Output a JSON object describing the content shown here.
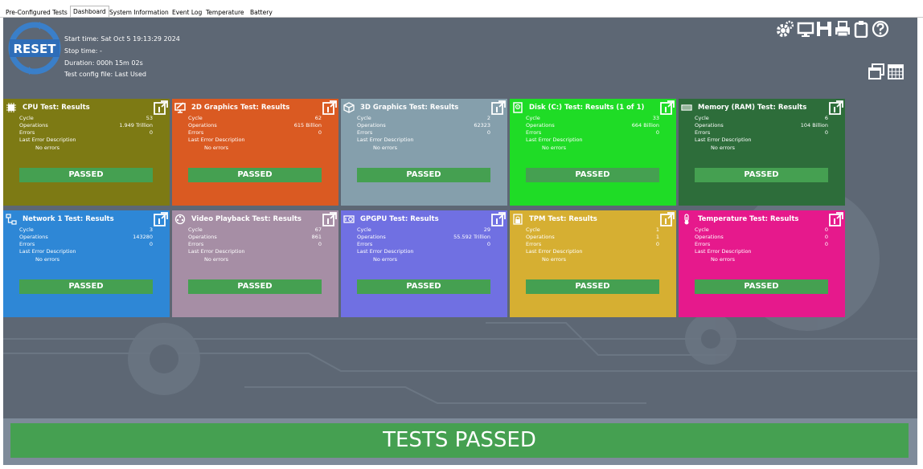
{
  "tabs": [
    {
      "label": "Pre-Configured Tests",
      "active": false
    },
    {
      "label": "Dashboard",
      "active": true
    },
    {
      "label": "System Information",
      "active": false
    },
    {
      "label": "Event Log",
      "active": false
    },
    {
      "label": "Temperature",
      "active": false
    },
    {
      "label": "Battery",
      "active": false
    }
  ],
  "reset_label": "RESET",
  "info": {
    "start_time": "Start time: Sat Oct  5 19:13:29 2024",
    "stop_time": "Stop time: -",
    "duration": "Duration: 000h 15m 02s",
    "config": "Test config file: Last Used"
  },
  "toolbar": [
    "gear-icon",
    "monitor-icon",
    "save-icon",
    "printer-icon",
    "clipboard-icon",
    "help-icon"
  ],
  "field_labels": {
    "cycle": "Cycle",
    "operations": "Operations",
    "errors": "Errors",
    "last_error": "Last Error Description"
  },
  "cards": [
    {
      "title": "CPU Test: Results",
      "icon": "cpu-icon",
      "color": "#7d7a14",
      "cycle": "53",
      "operations": "1.949 Trillion",
      "errors": "0",
      "error_desc": "No errors",
      "status": "PASSED"
    },
    {
      "title": "2D Graphics Test: Results",
      "icon": "2d-graphics-icon",
      "color": "#da5a22",
      "cycle": "62",
      "operations": "615 Billion",
      "errors": "0",
      "error_desc": "No errors",
      "status": "PASSED"
    },
    {
      "title": "3D Graphics Test: Results",
      "icon": "3d-graphics-icon",
      "color": "#859fac",
      "cycle": "2",
      "operations": "62323",
      "errors": "0",
      "error_desc": "No errors",
      "status": "PASSED"
    },
    {
      "title": "Disk (C:) Test: Results (1 of 1)",
      "icon": "disk-icon",
      "color": "#1fdc26",
      "cycle": "33",
      "operations": "664 Billion",
      "errors": "0",
      "error_desc": "No errors",
      "status": "PASSED"
    },
    {
      "title": "Memory (RAM) Test: Results",
      "icon": "memory-icon",
      "color": "#2d6d3a",
      "cycle": "6",
      "operations": "104 Billion",
      "errors": "0",
      "error_desc": "No errors",
      "status": "PASSED"
    },
    {
      "title": "Network 1 Test: Results",
      "icon": "network-icon",
      "color": "#2e87d6",
      "cycle": "3",
      "operations": "143280",
      "errors": "0",
      "error_desc": "No errors",
      "status": "PASSED"
    },
    {
      "title": "Video Playback Test: Results",
      "icon": "video-icon",
      "color": "#a68ea5",
      "cycle": "67",
      "operations": "861",
      "errors": "0",
      "error_desc": "No errors",
      "status": "PASSED"
    },
    {
      "title": "GPGPU Test: Results",
      "icon": "gpgpu-icon",
      "color": "#7070e2",
      "cycle": "29",
      "operations": "55.592 Trillion",
      "errors": "0",
      "error_desc": "No errors",
      "status": "PASSED"
    },
    {
      "title": "TPM Test: Results",
      "icon": "tpm-icon",
      "color": "#d6af32",
      "cycle": "1",
      "operations": "1",
      "errors": "0",
      "error_desc": "No errors",
      "status": "PASSED"
    },
    {
      "title": "Temperature Test: Results",
      "icon": "thermometer-icon",
      "color": "#e6198c",
      "cycle": "0",
      "operations": "0",
      "errors": "0",
      "error_desc": "No errors",
      "status": "PASSED"
    }
  ],
  "overall_status": "TESTS PASSED",
  "colors": {
    "passed": "#45a051",
    "background": "#5d6774",
    "footer": "#7e8b9a"
  }
}
